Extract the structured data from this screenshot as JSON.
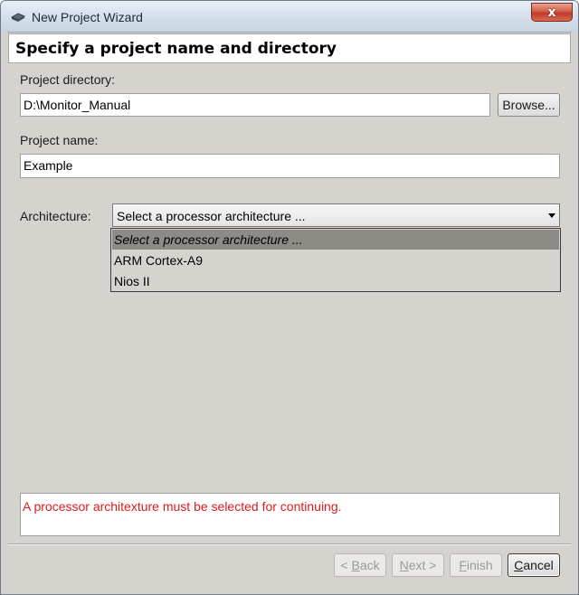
{
  "window": {
    "title": "New Project Wizard",
    "close_label": "x"
  },
  "header": {
    "title": "Specify a project name and directory"
  },
  "form": {
    "directory_label": "Project directory:",
    "directory_value": "D:\\Monitor_Manual",
    "browse_label": "Browse...",
    "name_label": "Project name:",
    "name_value": "Example",
    "architecture_label": "Architecture:",
    "architecture_selected": "Select a processor architecture ...",
    "architecture_options": [
      "Select a processor architecture ...",
      "ARM Cortex-A9",
      "Nios II"
    ]
  },
  "message": {
    "text": "A processor architexture must be selected for continuing.",
    "color": "#e01b1b"
  },
  "buttons": {
    "back": {
      "prefix": "< ",
      "mnemonic": "B",
      "rest": "ack",
      "enabled": false
    },
    "next": {
      "mnemonic": "N",
      "rest": "ext >",
      "enabled": false
    },
    "finish": {
      "mnemonic": "F",
      "rest": "inish",
      "enabled": false
    },
    "cancel": {
      "mnemonic": "C",
      "rest": "ancel",
      "enabled": true
    }
  },
  "icons": {
    "app": "chip-icon",
    "close": "close-icon",
    "dropdown": "chevron-down-icon"
  }
}
